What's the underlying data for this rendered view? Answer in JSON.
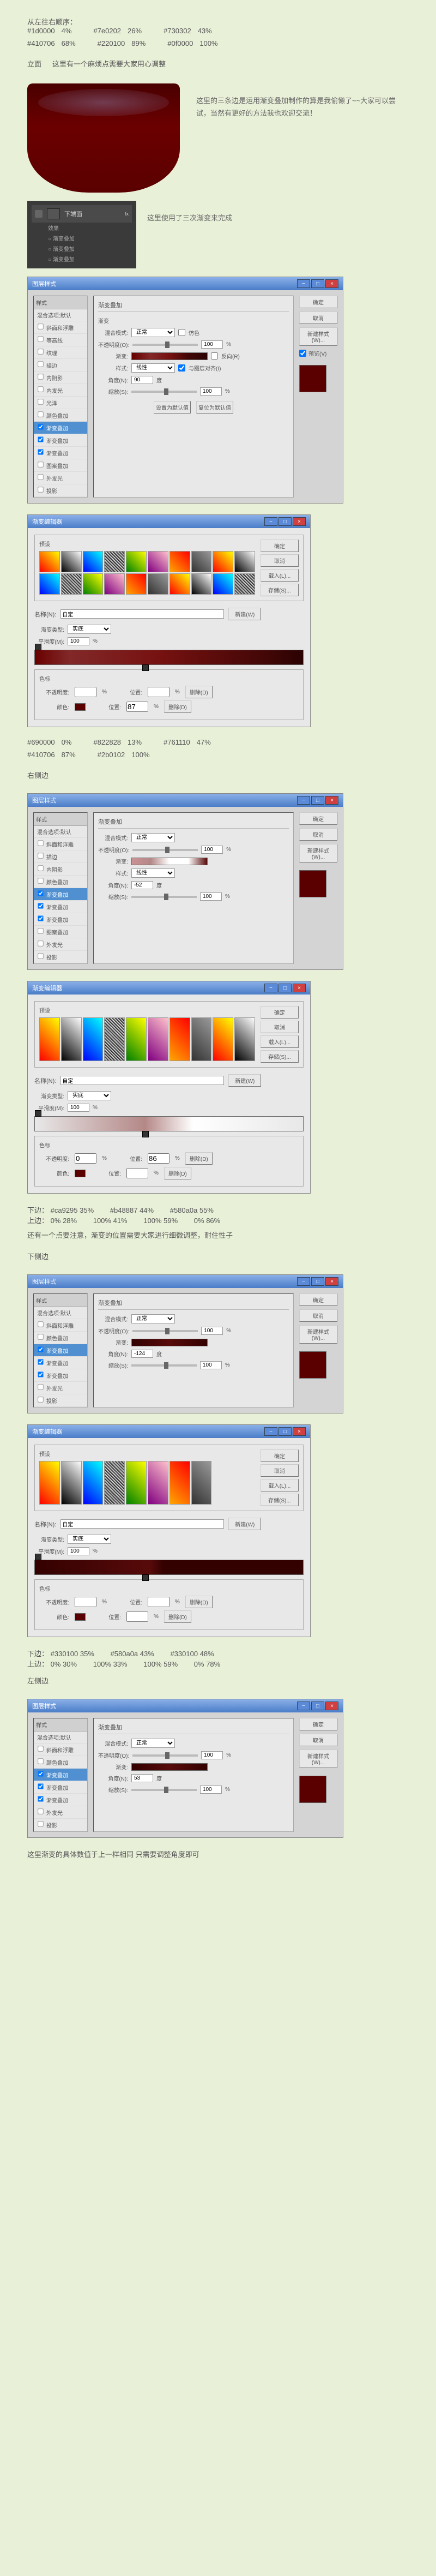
{
  "header": {
    "order_label": "从左往右顺序：",
    "row1": [
      {
        "hex": "#1d0000",
        "pct": "4%"
      },
      {
        "hex": "#7e0202",
        "pct": "26%"
      },
      {
        "hex": "#730302",
        "pct": "43%"
      }
    ],
    "row2": [
      {
        "hex": "#410706",
        "pct": "68%"
      },
      {
        "hex": "#220100",
        "pct": "89%"
      },
      {
        "hex": "#0f0000",
        "pct": "100%"
      }
    ],
    "front_label": "立面",
    "front_note": "这里有一个麻烦点需要大家用心调整"
  },
  "cup": {
    "side_note": "这里的三条边是运用渐变叠加制作的算是我偷懒了~~大家可以尝试，当然有更好的方法我也欢迎交流！"
  },
  "layers": {
    "side_note": "这里使用了三次渐变来完成",
    "title": "图层",
    "layer_name": "下端面",
    "fx_label": "效果",
    "fx_items": [
      "渐变叠加",
      "渐变叠加",
      "渐变叠加"
    ]
  },
  "style_dialog": {
    "title": "图层样式",
    "list_header": "样式",
    "items": [
      "混合选项:默认",
      "斜面和浮雕",
      "等高线",
      "纹理",
      "描边",
      "内阴影",
      "内发光",
      "光泽",
      "颜色叠加",
      "渐变叠加",
      "图案叠加",
      "外发光",
      "投影"
    ],
    "selected": "渐变叠加",
    "section_title": "渐变叠加",
    "sub_title": "渐变",
    "blend_label": "混合模式:",
    "blend_value": "正常",
    "dither_label": "仿色",
    "opacity_label": "不透明度(O):",
    "opacity_value": "100",
    "gradient_label": "渐变:",
    "reverse_label": "反向(R)",
    "style_label": "样式:",
    "style_value": "线性",
    "align_label": "与图层对齐(I)",
    "angle_label": "角度(N):",
    "angle_value": "90",
    "angle_unit": "度",
    "scale_label": "缩放(S):",
    "scale_value": "100",
    "scale_unit": "%",
    "reset_default": "设置为默认值",
    "restore_default": "复位为默认值",
    "btn_ok": "确定",
    "btn_cancel": "取消",
    "btn_new": "新建样式(W)...",
    "btn_preview": "预览(V)"
  },
  "grad_editor": {
    "title": "渐变编辑器",
    "presets_label": "预设",
    "btn_ok": "确定",
    "btn_cancel": "取消",
    "btn_load": "载入(L)...",
    "btn_save": "存储(S)...",
    "name_label": "名称(N):",
    "name_value": "自定",
    "btn_new": "新建(W)",
    "type_label": "渐变类型:",
    "type_value": "实底",
    "smooth_label": "平滑度(M):",
    "smooth_value": "100",
    "smooth_unit": "%",
    "stops_title": "色标",
    "opacity_label": "不透明度:",
    "opacity_unit": "%",
    "position_label": "位置:",
    "position_unit": "%",
    "color_label": "颜色:",
    "delete_label": "删除(D)"
  },
  "section2": {
    "row1": [
      {
        "hex": "#690000",
        "pct": "0%"
      },
      {
        "hex": "#822828",
        "pct": "13%"
      },
      {
        "hex": "#761110",
        "pct": "47%"
      }
    ],
    "row2": [
      {
        "hex": "#410706",
        "pct": "87%"
      },
      {
        "hex": "#2b0102",
        "pct": "100%"
      }
    ],
    "label": "右侧边"
  },
  "section3": {
    "bottom_label": "下边：",
    "bottom_stops": [
      {
        "hex": "#ca9295",
        "pct": "35%"
      },
      {
        "hex": "#b48887",
        "pct": "44%"
      },
      {
        "hex": "#580a0a",
        "pct": "55%"
      }
    ],
    "top_label": "上边：",
    "top_stops": [
      {
        "hex": "0%",
        "pct": "28%"
      },
      {
        "hex": "100%",
        "pct": "41%"
      },
      {
        "hex": "100%",
        "pct": "59%"
      },
      {
        "hex": "0%",
        "pct": "86%"
      }
    ],
    "note": "还有一个点要注意，渐变的位置需要大家进行细微调整，耐住性子",
    "label": "下侧边"
  },
  "section4": {
    "bottom_label": "下边：",
    "bottom_stops": [
      {
        "hex": "#330100",
        "pct": "35%"
      },
      {
        "hex": "#580a0a",
        "pct": "43%"
      },
      {
        "hex": "#330100",
        "pct": "48%"
      }
    ],
    "top_label": "上边：",
    "top_stops": [
      {
        "hex": "0%",
        "pct": "30%"
      },
      {
        "hex": "100%",
        "pct": "33%"
      },
      {
        "hex": "100%",
        "pct": "59%"
      },
      {
        "hex": "0%",
        "pct": "78%"
      }
    ],
    "label": "左侧边"
  },
  "footer_note": "这里渐变的具体数值于上一样相同    只需要调整角度即可"
}
